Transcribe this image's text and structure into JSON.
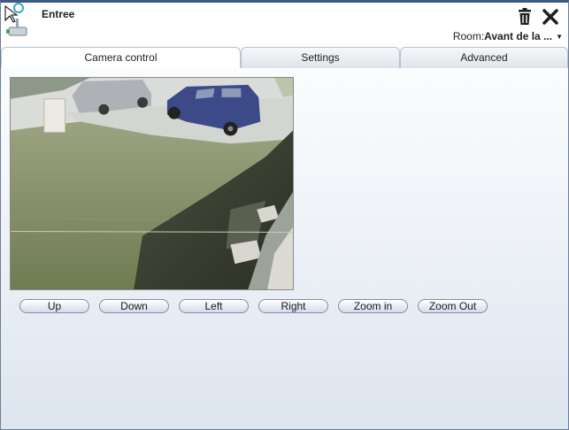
{
  "window": {
    "title": "Entree"
  },
  "header": {
    "room_label": "Room:",
    "room_value": "Avant de la ...",
    "icons": [
      "camera-icon",
      "trash-icon",
      "close-icon",
      "chevron-down-icon"
    ]
  },
  "tabs": [
    {
      "label": "Camera control",
      "active": true
    },
    {
      "label": "Settings",
      "active": false
    },
    {
      "label": "Advanced",
      "active": false
    }
  ],
  "controls": {
    "up": "Up",
    "down": "Down",
    "left": "Left",
    "right": "Right",
    "zoom_in": "Zoom in",
    "zoom_out": "Zoom Out"
  },
  "colors": {
    "window_border": "#3d5a80",
    "button_border": "#7e8fa5",
    "grass": "#7f8d63",
    "van": "#3c4a8a"
  }
}
